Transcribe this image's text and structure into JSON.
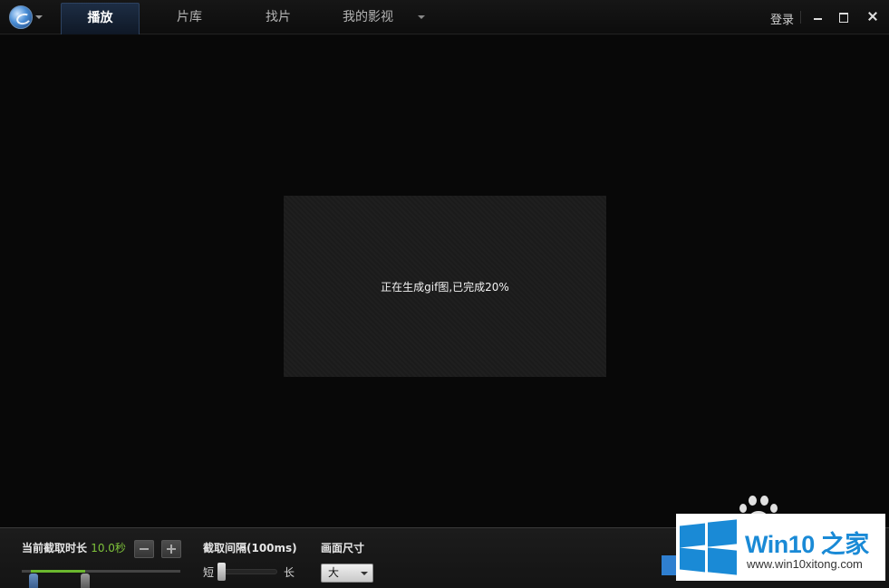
{
  "header": {
    "tabs": [
      {
        "label": "播放",
        "active": true
      },
      {
        "label": "片库",
        "active": false
      },
      {
        "label": "找片",
        "active": false
      },
      {
        "label": "我的影视",
        "active": false
      }
    ],
    "login_label": "登录",
    "icons": [
      "app-logo-icon",
      "chevron-down-icon",
      "minimize-icon",
      "maximize-icon",
      "close-icon"
    ]
  },
  "video": {
    "status_text": "正在生成gif图,已完成20%",
    "progress_percent": 20
  },
  "bottom": {
    "duration_label": "当前截取时长",
    "duration_value": "10.0秒",
    "interval_label": "截取间隔(100ms)",
    "interval_short": "短",
    "interval_long": "长",
    "size_label": "画面尺寸",
    "size_value": "大"
  },
  "watermark": {
    "title": "Win10 之家",
    "url": "www.win10xitong.com"
  },
  "colors": {
    "accent_blue": "#1a8ad6",
    "duration_green": "#7ec23a"
  }
}
